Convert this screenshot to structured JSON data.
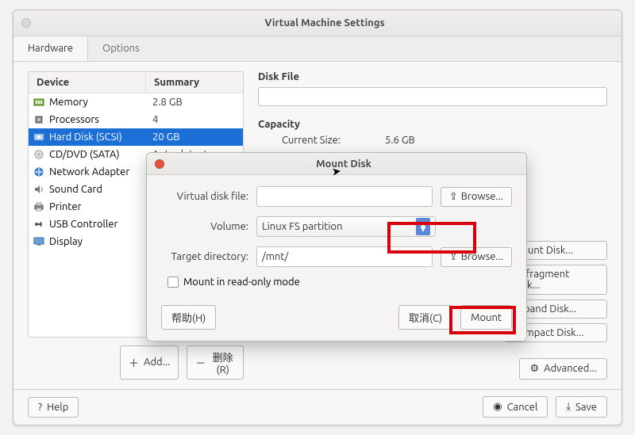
{
  "colors": {
    "selection": "#1d6fd8",
    "highlight": "#d8000c",
    "close_button": "#e2553b"
  },
  "window": {
    "title": "Virtual Machine Settings",
    "tabs": [
      "Hardware",
      "Options"
    ],
    "active_tab": 0
  },
  "device_table": {
    "headers": {
      "device": "Device",
      "summary": "Summary"
    },
    "rows": [
      {
        "icon": "memory-icon",
        "name": "Memory",
        "summary": "2.8 GB",
        "selected": false
      },
      {
        "icon": "cpu-icon",
        "name": "Processors",
        "summary": "4",
        "selected": false
      },
      {
        "icon": "disk-icon",
        "name": "Hard Disk (SCSI)",
        "summary": "20 GB",
        "selected": true
      },
      {
        "icon": "cd-icon",
        "name": "CD/DVD (SATA)",
        "summary": "Auto detect",
        "selected": false
      },
      {
        "icon": "network-icon",
        "name": "Network Adapter",
        "summary": "",
        "selected": false
      },
      {
        "icon": "sound-icon",
        "name": "Sound Card",
        "summary": "",
        "selected": false
      },
      {
        "icon": "printer-icon",
        "name": "Printer",
        "summary": "",
        "selected": false
      },
      {
        "icon": "usb-icon",
        "name": "USB Controller",
        "summary": "",
        "selected": false
      },
      {
        "icon": "display-icon",
        "name": "Display",
        "summary": "",
        "selected": false
      }
    ],
    "add_button": "Add...",
    "remove_button": "删除(R)"
  },
  "detail": {
    "disk_file_label": "Disk File",
    "disk_file_value": "",
    "capacity_label": "Capacity",
    "current_size_label": "Current Size:",
    "current_size_value": "5.6 GB",
    "utilities": {
      "mount": "Mount Disk...",
      "defragment": "Defragment Disk...",
      "expand": "Expand Disk...",
      "compact": "Compact Disk..."
    },
    "advanced_button": "Advanced..."
  },
  "bottom": {
    "help": "Help",
    "cancel": "Cancel",
    "save": "Save"
  },
  "modal": {
    "title": "Mount Disk",
    "vdisk_label": "Virtual disk file:",
    "vdisk_value": "",
    "volume_label": "Volume:",
    "volume_value": "Linux FS partition",
    "target_label": "Target directory:",
    "target_value": "/mnt/",
    "readonly_label": "Mount in read-only mode",
    "readonly_checked": false,
    "browse": "Browse...",
    "help": "帮助(H)",
    "cancel": "取消(C)",
    "mount": "Mount"
  }
}
